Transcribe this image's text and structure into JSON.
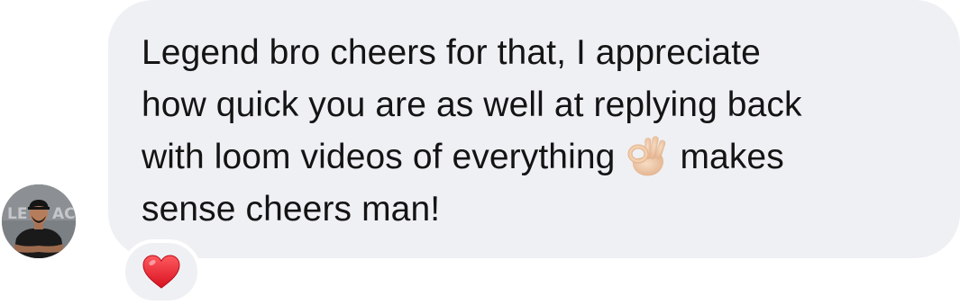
{
  "message": {
    "line1": "Legend bro cheers for that, I appreciate",
    "line2": "how quick you are as well at replying back",
    "line3_pre": "with loom videos of everything",
    "line3_post": "makes",
    "line4": "sense cheers man!",
    "inline_emoji": "ok-hand-emoji"
  },
  "avatar": {
    "icon": "profile-photo",
    "shirt_text": "LEGACY"
  },
  "reaction": {
    "icon": "heart-icon",
    "color": "#e8202f"
  },
  "colors": {
    "bubble_bg": "#eff0f4",
    "text": "#141414",
    "page_bg": "#ffffff"
  }
}
